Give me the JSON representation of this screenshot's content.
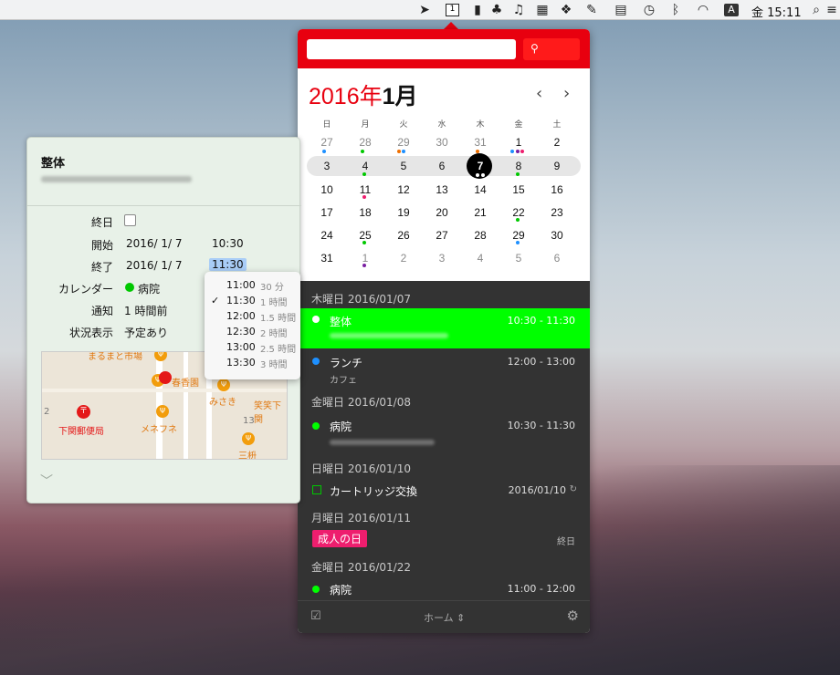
{
  "menubar": {
    "clock": "金 15:11",
    "ime": "A",
    "cal_icon": "1"
  },
  "calendar": {
    "year_label": "2016年",
    "month_label": "1月",
    "prev": "‹",
    "next": "›",
    "dow": [
      "日",
      "月",
      "火",
      "水",
      "木",
      "金",
      "土"
    ],
    "weeks": [
      [
        "27",
        "28",
        "29",
        "30",
        "31",
        "1",
        "2"
      ],
      [
        "3",
        "4",
        "5",
        "6",
        "7",
        "8",
        "9"
      ],
      [
        "10",
        "11",
        "12",
        "13",
        "14",
        "15",
        "16"
      ],
      [
        "17",
        "18",
        "19",
        "20",
        "21",
        "22",
        "23"
      ],
      [
        "24",
        "25",
        "26",
        "27",
        "28",
        "29",
        "30"
      ],
      [
        "31",
        "1",
        "2",
        "3",
        "4",
        "5",
        "6"
      ]
    ]
  },
  "events": {
    "h1": "木曜日 2016/01/07",
    "e1_name": "整体",
    "e1_time": "10:30 - 11:30",
    "e2_name": "ランチ",
    "e2_sub": "カフェ",
    "e2_time": "12:00 - 13:00",
    "h2": "金曜日 2016/01/08",
    "e3_name": "病院",
    "e3_time": "10:30 - 11:30",
    "h3": "日曜日 2016/01/10",
    "e4_name": "カートリッジ交換",
    "e4_time": "2016/01/10",
    "h4": "月曜日 2016/01/11",
    "e5_name": "成人の日",
    "e5_time": "終日",
    "h5": "金曜日 2016/01/22",
    "e6_name": "病院",
    "e6_time": "11:00 - 12:00",
    "footer_calendar": "ホーム ⇕"
  },
  "detail": {
    "title": "整体",
    "allday_label": "終日",
    "start_label": "開始",
    "start_date": "2016/ 1/ 7",
    "start_time": "10:30",
    "end_label": "終了",
    "end_date": "2016/ 1/ 7",
    "end_time": "11:30",
    "cal_label": "カレンダー",
    "cal_value": "病院",
    "alert_label": "通知",
    "alert_value": "1 時間前",
    "status_label": "状況表示",
    "status_value": "予定あり",
    "map": {
      "l1": "春香園",
      "l2": "みさき",
      "l3": "下関郵便局",
      "l4": "メネフネ",
      "l5": "笑笑下関",
      "l6": "13",
      "l7": "三枡",
      "l8": "まるまと市場",
      "l9": "2"
    }
  },
  "time_dropdown": [
    {
      "t": "11:00",
      "d": "30 分",
      "c": ""
    },
    {
      "t": "11:30",
      "d": "1 時間",
      "c": "✓"
    },
    {
      "t": "12:00",
      "d": "1.5 時間",
      "c": ""
    },
    {
      "t": "12:30",
      "d": "2 時間",
      "c": ""
    },
    {
      "t": "13:00",
      "d": "2.5 時間",
      "c": ""
    },
    {
      "t": "13:30",
      "d": "3 時間",
      "c": ""
    }
  ],
  "colors": {
    "accent": "#e8000f",
    "green": "#00ff00",
    "blue": "#1e90ff",
    "pink": "#ee1e6e",
    "purple": "#7a1fa2"
  }
}
